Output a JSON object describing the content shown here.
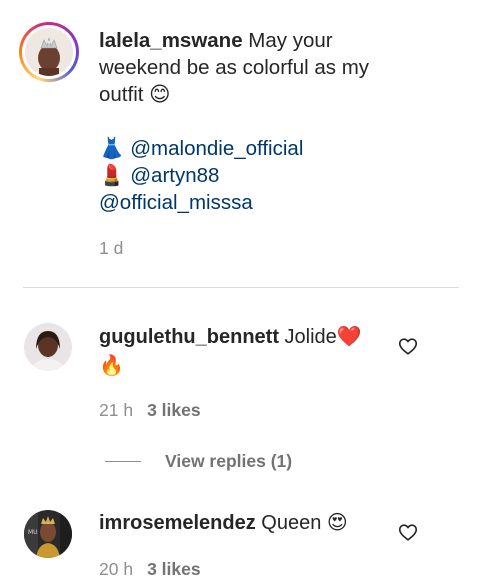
{
  "post_caption": {
    "username": "lalela_mswane",
    "text_line1": "May your",
    "text_line2": "weekend be as colorful as my",
    "text_line3": "outfit",
    "emoji_smile": "😊",
    "emoji_dress": "👗",
    "mention_1": "@malondie_official",
    "emoji_lipstick": "💄",
    "mention_2": "@artyn88",
    "mention_3": "@official_misssa",
    "timestamp": "1 d",
    "avatar_icon": "profile-photo-crowned",
    "ring_colors": [
      "#feda75",
      "#fa7e1e",
      "#d62976",
      "#962fbf",
      "#4f5bd5"
    ]
  },
  "comments": [
    {
      "username": "gugulethu_bennett",
      "text": "Jolide",
      "emoji_1": "❤️",
      "emoji_2": "🔥",
      "time": "21 h",
      "likes": "3 likes",
      "like_icon": "heart-outline-icon",
      "view_replies": "View replies (1)"
    },
    {
      "username": "imrosemelendez",
      "text": "Queen",
      "emoji_1": "😍",
      "time": "20 h",
      "likes": "3 likes",
      "like_icon": "heart-outline-icon"
    }
  ],
  "colors": {
    "text": "#262626",
    "mention": "#00376b",
    "secondary": "#8e8e8e",
    "divider": "#dbdbdb"
  }
}
